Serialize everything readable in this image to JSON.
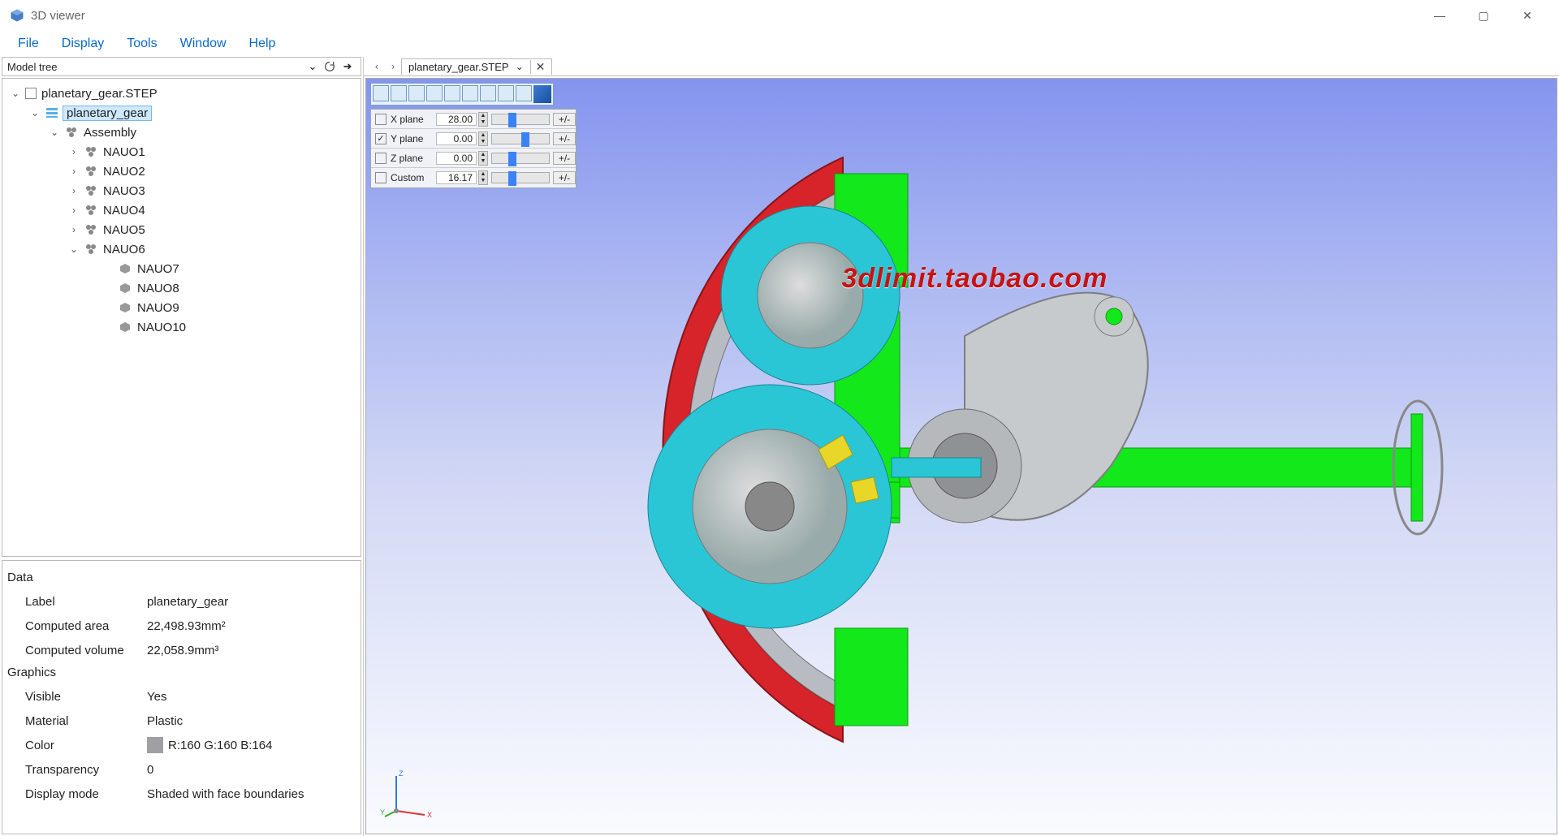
{
  "window": {
    "title": "3D viewer"
  },
  "menu": {
    "file": "File",
    "display": "Display",
    "tools": "Tools",
    "window": "Window",
    "help": "Help"
  },
  "treeHeader": "Model tree",
  "tree": {
    "root": "planetary_gear.STEP",
    "n1": "planetary_gear",
    "n2": "Assembly",
    "items": [
      "NAUO1",
      "NAUO2",
      "NAUO3",
      "NAUO4",
      "NAUO5",
      "NAUO6"
    ],
    "sub": [
      "NAUO7",
      "NAUO8",
      "NAUO9",
      "NAUO10"
    ]
  },
  "tab": {
    "name": "planetary_gear.STEP"
  },
  "clip": {
    "rows": [
      {
        "label": "X plane",
        "value": "28.00",
        "checked": false,
        "thumb": 20,
        "btn": "+/-"
      },
      {
        "label": "Y plane",
        "value": "0.00",
        "checked": true,
        "thumb": 36,
        "btn": "+/-"
      },
      {
        "label": "Z plane",
        "value": "0.00",
        "checked": false,
        "thumb": 20,
        "btn": "+/-"
      },
      {
        "label": "Custom",
        "value": "16.17",
        "checked": false,
        "thumb": 20,
        "btn": "+/-"
      }
    ]
  },
  "props": {
    "dataHdr": "Data",
    "label_k": "Label",
    "label_v": "planetary_gear",
    "area_k": "Computed area",
    "area_v": "22,498.93mm²",
    "vol_k": "Computed volume",
    "vol_v": "22,058.9mm³",
    "gfxHdr": "Graphics",
    "vis_k": "Visible",
    "vis_v": "Yes",
    "mat_k": "Material",
    "mat_v": "Plastic",
    "col_k": "Color",
    "col_v": "R:160 G:160 B:164",
    "tr_k": "Transparency",
    "tr_v": "0",
    "dm_k": "Display mode",
    "dm_v": "Shaded with face boundaries"
  },
  "watermark": "3dlimit.taobao.com",
  "axis": {
    "x": "X",
    "y": "Y",
    "z": "Z"
  }
}
